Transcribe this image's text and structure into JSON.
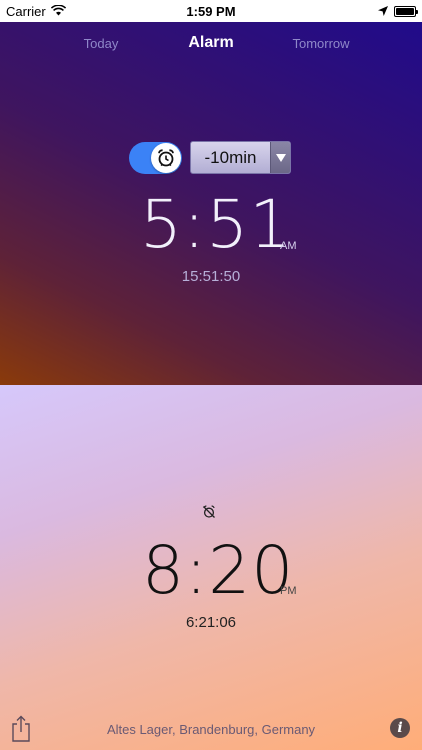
{
  "status_bar": {
    "carrier": "Carrier",
    "time": "1:59 PM",
    "icons": [
      "wifi-icon",
      "location-arrow-icon",
      "battery-icon"
    ]
  },
  "tabs": [
    {
      "label": "Today",
      "active": false
    },
    {
      "label": "Alarm",
      "active": true
    },
    {
      "label": "Tomorrow",
      "active": false
    }
  ],
  "alarm": {
    "enabled": true,
    "offset_value": "-10min",
    "time": "5:51",
    "ampm": "AM",
    "sub_time": "15:51:50"
  },
  "sunset": {
    "icon": "alarm-off-icon",
    "time": "8:20",
    "ampm": "PM",
    "sub_time": "6:21:06"
  },
  "footer": {
    "location": "Altes Lager, Brandenburg, Germany",
    "share_icon": "share-icon",
    "info_label": "i"
  },
  "colors": {
    "toggle_on": "#3b82f6",
    "top_gradient": [
      "#8a3a0a",
      "#1e0a8e"
    ],
    "bottom_gradient": [
      "#d6c8fb",
      "#ffad78"
    ]
  }
}
